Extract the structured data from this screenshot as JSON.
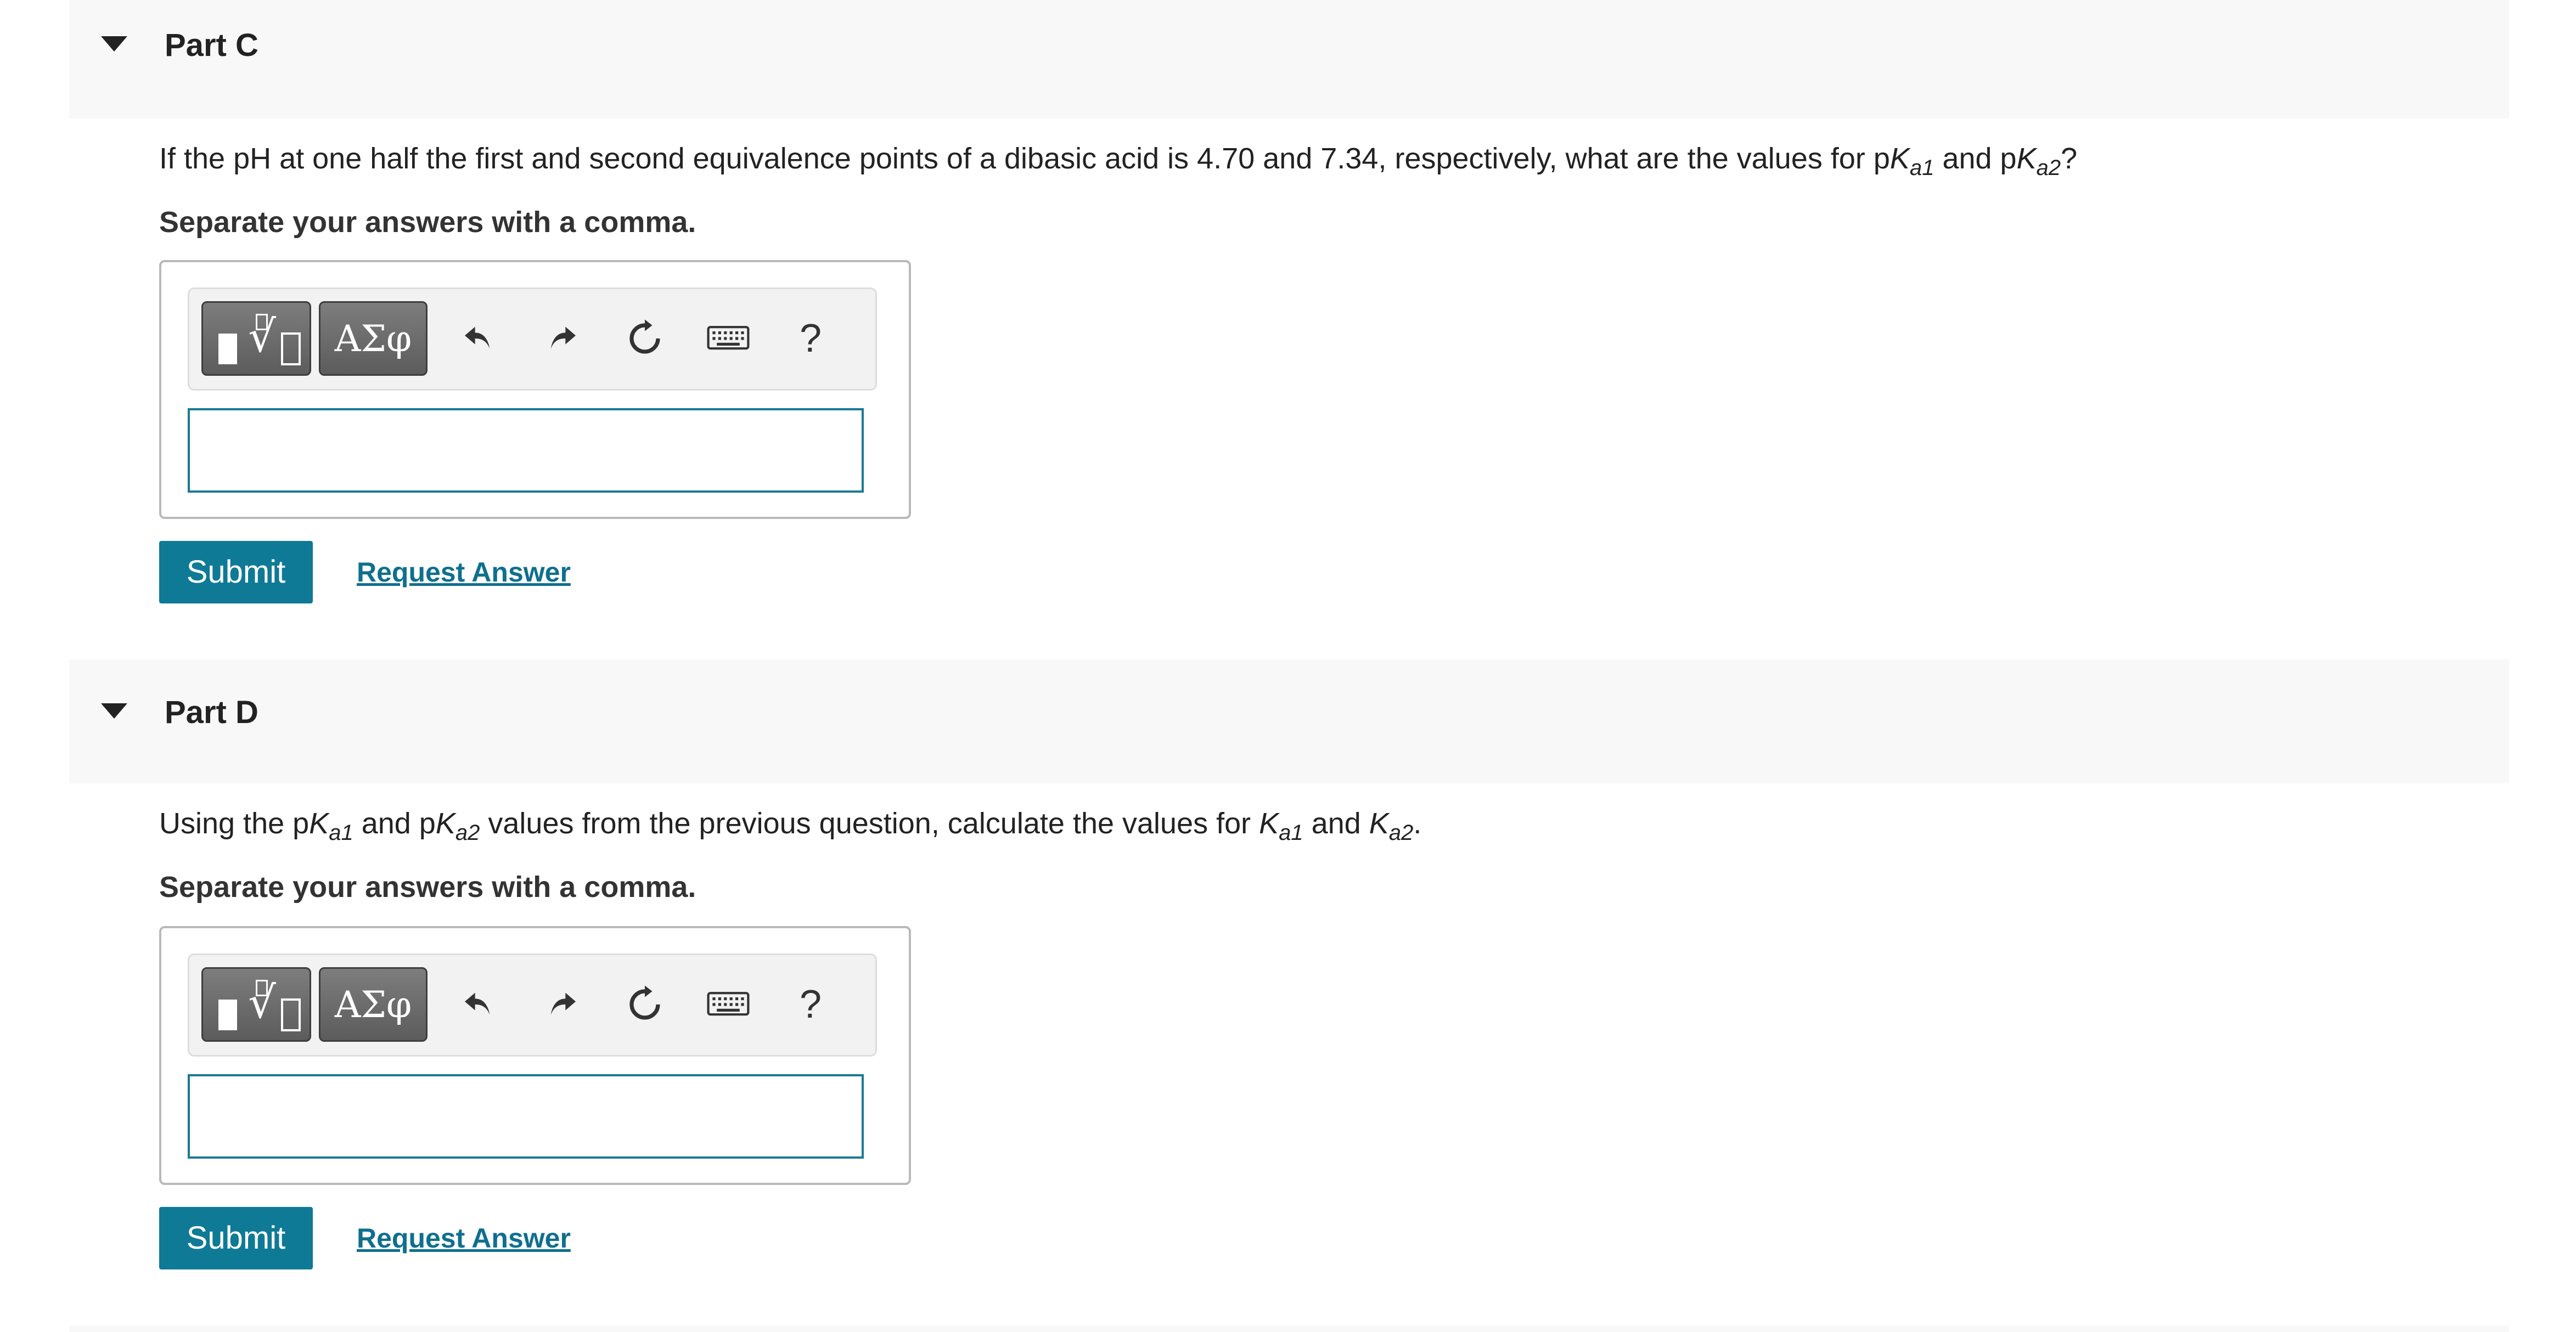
{
  "parts": [
    {
      "title": "Part C",
      "question": {
        "before": "If the pH at one half the first and second equivalence points of a dibasic acid is 4.70 and 7.34, respectively, what are the values for p",
        "var1": "K",
        "sub1": "a1",
        "mid": " and p",
        "var2": "K",
        "sub2": "a2",
        "after": "?"
      },
      "instruction": "Separate your answers with a comma.",
      "toolbar": {
        "greek_label": "ΑΣφ",
        "help_label": "?"
      },
      "answer": {
        "value": "",
        "placeholder": ""
      },
      "submit_label": "Submit",
      "request_answer_label": "Request Answer"
    },
    {
      "title": "Part D",
      "question": {
        "p1": "Using the p",
        "var1": "K",
        "sub1": "a1",
        "p2": " and p",
        "var2": "K",
        "sub2": "a2",
        "p3": " values from the previous question, calculate the values for ",
        "var3": "K",
        "sub3": "a1",
        "p4": " and ",
        "var4": "K",
        "sub4": "a2",
        "p5": "."
      },
      "instruction": "Separate your answers with a comma.",
      "toolbar": {
        "greek_label": "ΑΣφ",
        "help_label": "?"
      },
      "answer": {
        "value": "",
        "placeholder": ""
      },
      "submit_label": "Submit",
      "request_answer_label": "Request Answer"
    }
  ],
  "icons": {
    "collapse": "caret-down-icon",
    "templates": "templates-icon",
    "undo": "undo-icon",
    "redo": "redo-icon",
    "reset": "reset-icon",
    "keyboard": "keyboard-icon",
    "help": "help-icon"
  },
  "colors": {
    "accent": "#0f7a96",
    "link": "#0f6f8f",
    "header_bg": "#f8f8f8",
    "input_border": "#1a7a94"
  }
}
